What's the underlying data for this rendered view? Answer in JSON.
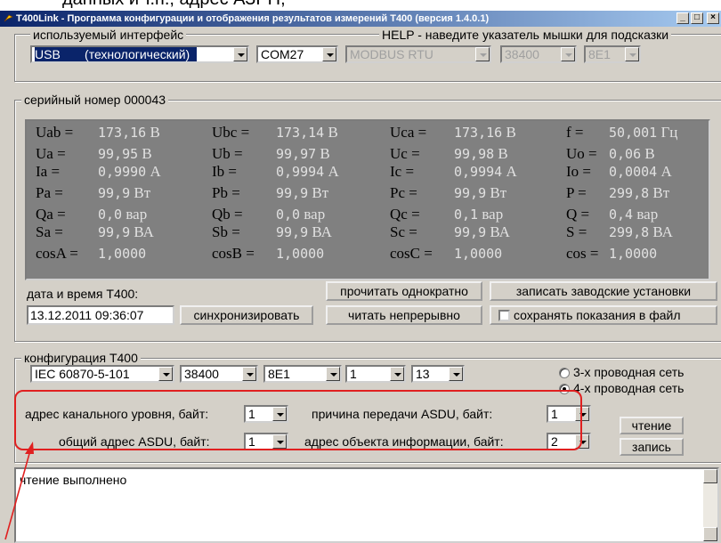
{
  "page_header_text": "данных и т.п., адрес АЗРН,",
  "window": {
    "title": "T400Link - Программа конфигурации и отображения результатов измерений Т400 (версия 1.4.0.1)",
    "controls": {
      "minimize": "_",
      "maximize": "□",
      "close": "×"
    }
  },
  "interface": {
    "group_label": "используемый интерфейс",
    "help_text": "HELP - наведите указатель мышки для подсказки",
    "type": "USB",
    "type_detail": "(технологический)",
    "port": "COM27",
    "protocol": "MODBUS RTU",
    "baud": "38400",
    "format": "8E1"
  },
  "serial": {
    "label": "серийный номер 000043",
    "rows": [
      [
        {
          "name": "Uab =",
          "value": "173,16",
          "unit": "В"
        },
        {
          "name": "Ubc =",
          "value": "173,14",
          "unit": "В"
        },
        {
          "name": "Uca =",
          "value": "173,16",
          "unit": "В"
        },
        {
          "name": "f =",
          "value": "50,001",
          "unit": "Гц"
        }
      ],
      [
        {
          "name": "Ua =",
          "value": "99,95",
          "unit": "В"
        },
        {
          "name": "Ub =",
          "value": "99,97",
          "unit": "В"
        },
        {
          "name": "Uc =",
          "value": "99,98",
          "unit": "В"
        },
        {
          "name": "Uo =",
          "value": "0,06",
          "unit": "В"
        }
      ],
      [
        {
          "name": "Ia =",
          "value": "0,9990",
          "unit": "А"
        },
        {
          "name": "Ib =",
          "value": "0,9994",
          "unit": "А"
        },
        {
          "name": "Ic =",
          "value": "0,9994",
          "unit": "А"
        },
        {
          "name": "Io =",
          "value": "0,0004",
          "unit": "А"
        }
      ],
      [
        {
          "name": "Pa =",
          "value": "99,9",
          "unit": "Вт"
        },
        {
          "name": "Pb =",
          "value": "99,9",
          "unit": "Вт"
        },
        {
          "name": "Pc =",
          "value": "99,9",
          "unit": "Вт"
        },
        {
          "name": "P =",
          "value": "299,8",
          "unit": "Вт"
        }
      ],
      [
        {
          "name": "Qa =",
          "value": "0,0",
          "unit": "вар"
        },
        {
          "name": "Qb =",
          "value": "0,0",
          "unit": "вар"
        },
        {
          "name": "Qc =",
          "value": "0,1",
          "unit": "вар"
        },
        {
          "name": "Q =",
          "value": "0,4",
          "unit": "вар"
        }
      ],
      [
        {
          "name": "Sa =",
          "value": "99,9",
          "unit": "ВА"
        },
        {
          "name": "Sb =",
          "value": "99,9",
          "unit": "ВА"
        },
        {
          "name": "Sc =",
          "value": "99,9",
          "unit": "ВА"
        },
        {
          "name": "S =",
          "value": "299,8",
          "unit": "ВА"
        }
      ],
      [
        {
          "name": "cosA =",
          "value": "1,0000",
          "unit": ""
        },
        {
          "name": "cosB =",
          "value": "1,0000",
          "unit": ""
        },
        {
          "name": "cosC =",
          "value": "1,0000",
          "unit": ""
        },
        {
          "name": "cos =",
          "value": "1,0000",
          "unit": ""
        }
      ]
    ]
  },
  "datetime": {
    "label": "дата и время Т400:",
    "value": "13.12.2011 09:36:07",
    "sync_button": "синхронизировать"
  },
  "actions": {
    "read_once": "прочитать однократно",
    "write_factory": "записать заводские установки",
    "read_continuous": "читать непрерывно",
    "save_to_file": "сохранять показания в файл"
  },
  "config": {
    "group_label": "конфигурация Т400",
    "protocol": "IEC 60870-5-101",
    "baud": "38400",
    "format": "8E1",
    "field4": "1",
    "field5": "13",
    "radio_3wire": "3-х проводная сеть",
    "radio_4wire": "4-х проводная сеть",
    "selected_wiring": "4-wire",
    "link_addr_label": "адрес канального уровня, байт:",
    "link_addr_value": "1",
    "cot_label": "причина передачи ASDU, байт:",
    "cot_value": "1",
    "common_addr_label": "общий адрес ASDU, байт:",
    "common_addr_value": "1",
    "ioa_label": "адрес объекта информации, байт:",
    "ioa_value": "2",
    "read_button": "чтение",
    "write_button": "запись"
  },
  "log": {
    "text": "чтение выполнено"
  },
  "colors": {
    "title_start": "#0a246a",
    "title_end": "#a6caf0",
    "face": "#d4d0c8",
    "measurements_bg": "#808080",
    "highlight": "#e02020"
  }
}
